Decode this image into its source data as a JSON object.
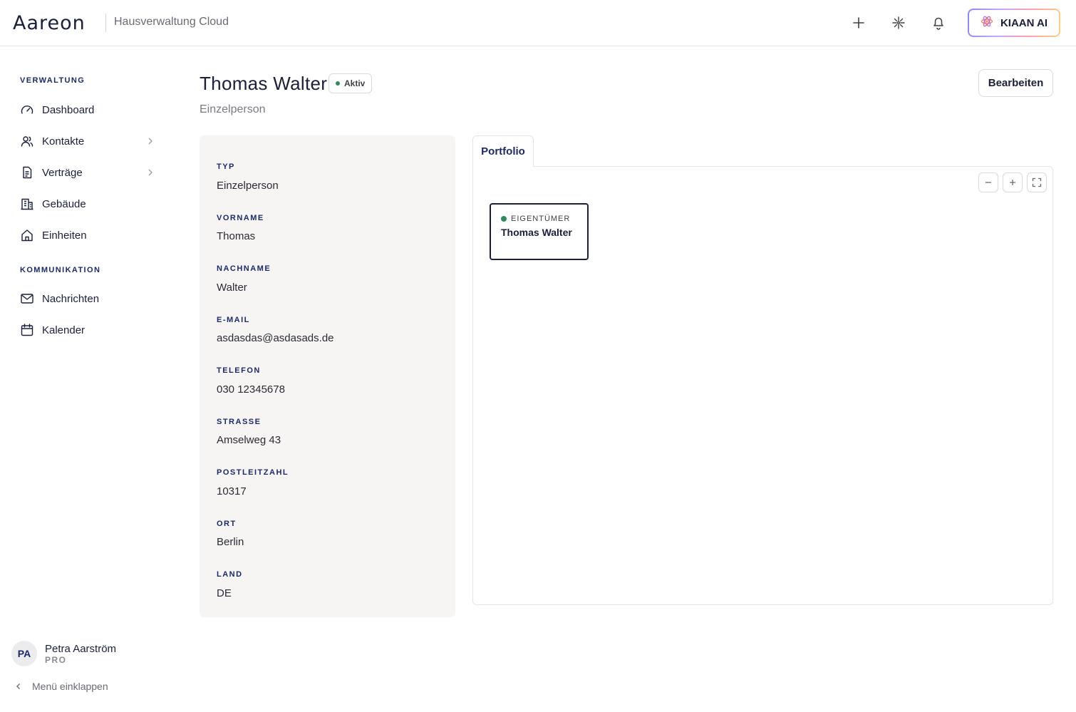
{
  "header": {
    "logo_text": "Aareon",
    "app_name": "Hausverwaltung Cloud",
    "ai_button_label": "KIAAN AI",
    "icons": [
      "plus-icon",
      "sparkle-icon",
      "bell-icon"
    ]
  },
  "sidebar": {
    "sections": [
      {
        "title": "VERWALTUNG",
        "items": [
          {
            "label": "Dashboard",
            "icon": "gauge-icon",
            "has_children": false
          },
          {
            "label": "Kontakte",
            "icon": "users-icon",
            "has_children": true
          },
          {
            "label": "Verträge",
            "icon": "document-icon",
            "has_children": true
          },
          {
            "label": "Gebäude",
            "icon": "building-icon",
            "has_children": false
          },
          {
            "label": "Einheiten",
            "icon": "home-icon",
            "has_children": false
          }
        ]
      },
      {
        "title": "KOMMUNIKATION",
        "items": [
          {
            "label": "Nachrichten",
            "icon": "mail-icon",
            "has_children": false
          },
          {
            "label": "Kalender",
            "icon": "calendar-icon",
            "has_children": false
          }
        ]
      }
    ],
    "user": {
      "initials": "PA",
      "name": "Petra Aarström",
      "tier": "PRO"
    },
    "collapse_label": "Menü einklappen"
  },
  "contact": {
    "name": "Thomas Walter",
    "status": "Aktiv",
    "type_subtitle": "Einzelperson",
    "edit_label": "Bearbeiten",
    "fields": [
      {
        "label": "TYP",
        "value": "Einzelperson"
      },
      {
        "label": "VORNAME",
        "value": "Thomas"
      },
      {
        "label": "NACHNAME",
        "value": "Walter"
      },
      {
        "label": "E-MAIL",
        "value": "asdasdas@asdasads.de"
      },
      {
        "label": "TELEFON",
        "value": "030 12345678"
      },
      {
        "label": "STRASSE",
        "value": "Amselweg 43"
      },
      {
        "label": "POSTLEITZAHL",
        "value": "10317"
      },
      {
        "label": "ORT",
        "value": "Berlin"
      },
      {
        "label": "LAND",
        "value": "DE"
      }
    ]
  },
  "portfolio": {
    "tab_label": "Portfolio",
    "node": {
      "role": "EIGENTÜMER",
      "name": "Thomas Walter"
    },
    "colors": {
      "status_dot": "#2e8b57"
    }
  }
}
